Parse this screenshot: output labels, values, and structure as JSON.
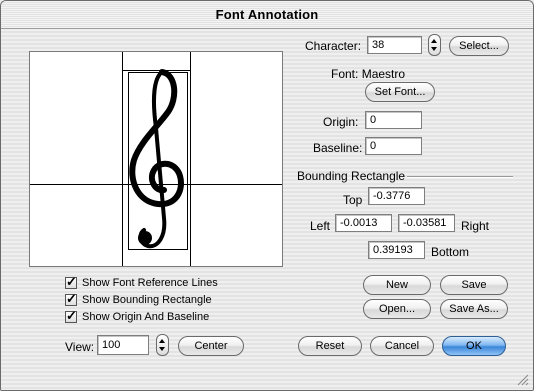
{
  "window": {
    "title": "Font Annotation"
  },
  "character": {
    "label": "Character:",
    "value": "38",
    "select_label": "Select..."
  },
  "font": {
    "label": "Font:",
    "name": "Maestro",
    "set_font_label": "Set Font..."
  },
  "origin": {
    "label": "Origin:",
    "value": "0"
  },
  "baseline": {
    "label": "Baseline:",
    "value": "0"
  },
  "bounding_rectangle": {
    "heading": "Bounding Rectangle",
    "top_label": "Top",
    "top_value": "-0.3776",
    "left_label": "Left",
    "left_value": "-0.0013",
    "right_label": "Right",
    "right_value": "-0.03581",
    "bottom_label": "Bottom",
    "bottom_value": "0.39193"
  },
  "checkboxes": [
    {
      "label": "Show Font Reference Lines",
      "checked": true
    },
    {
      "label": "Show Bounding Rectangle",
      "checked": true
    },
    {
      "label": "Show Origin And Baseline",
      "checked": true
    }
  ],
  "view": {
    "label": "View:",
    "value": "100",
    "center_label": "Center"
  },
  "buttons": {
    "new": "New",
    "save": "Save",
    "open": "Open...",
    "save_as": "Save As...",
    "reset": "Reset",
    "cancel": "Cancel",
    "ok": "OK"
  },
  "preview": {
    "glyph": "𝄞",
    "glyph_name": "treble-clef"
  },
  "colors": {
    "default_button": "#3c87d9"
  }
}
